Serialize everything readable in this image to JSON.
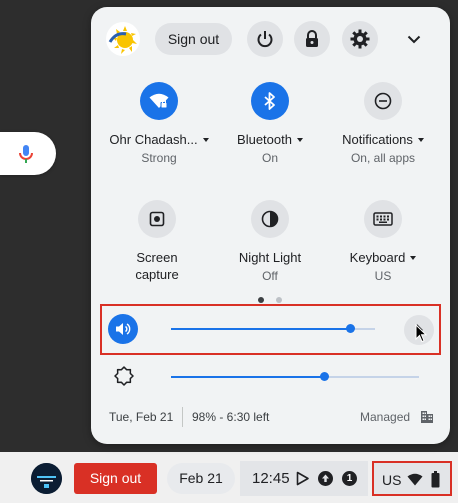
{
  "background": {
    "color": "#2d2d2d"
  },
  "mic_icon": "mic-icon",
  "header": {
    "sign_out_label": "Sign out"
  },
  "tiles_row1": [
    {
      "label": "Ohr Chadash...",
      "sub": "Strong",
      "icon": "wifi-lock-icon",
      "active": true
    },
    {
      "label": "Bluetooth",
      "sub": "On",
      "icon": "bluetooth-icon",
      "active": true
    },
    {
      "label": "Notifications",
      "sub": "On, all apps",
      "icon": "notifications-icon",
      "active": false
    }
  ],
  "tiles_row2": [
    {
      "label_line1": "Screen",
      "label_line2": "capture",
      "icon": "screen-capture-icon"
    },
    {
      "label": "Night Light",
      "sub": "Off",
      "icon": "night-light-icon"
    },
    {
      "label": "Keyboard",
      "sub": "US",
      "icon": "keyboard-icon"
    }
  ],
  "volume": {
    "level": 0.88
  },
  "brightness": {
    "level": 0.62
  },
  "footer": {
    "date": "Tue, Feb 21",
    "battery": "98% - 6:30 left",
    "managed": "Managed"
  },
  "shelf": {
    "sign_out_label": "Sign out",
    "date": "Feb 21",
    "time": "12:45",
    "notification_count": "1",
    "ime": "US"
  },
  "colors": {
    "accent": "#1a73e8",
    "danger": "#d93025",
    "panel": "#f1f3f4"
  }
}
